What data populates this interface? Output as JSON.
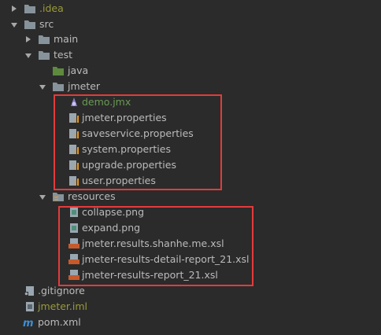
{
  "tree": {
    "idea": {
      "label": ".idea",
      "icon": "folder-icon"
    },
    "src": {
      "label": "src",
      "icon": "folder-icon"
    },
    "main": {
      "label": "main",
      "icon": "folder-icon"
    },
    "test": {
      "label": "test",
      "icon": "folder-icon"
    },
    "java": {
      "label": "java",
      "icon": "source-folder-icon"
    },
    "jmeter": {
      "label": "jmeter",
      "icon": "folder-icon"
    },
    "jmeter_files": [
      {
        "label": "demo.jmx",
        "icon": "jmx-file-icon"
      },
      {
        "label": "jmeter.properties",
        "icon": "properties-file-icon"
      },
      {
        "label": "saveservice.properties",
        "icon": "properties-file-icon"
      },
      {
        "label": "system.properties",
        "icon": "properties-file-icon"
      },
      {
        "label": "upgrade.properties",
        "icon": "properties-file-icon"
      },
      {
        "label": "user.properties",
        "icon": "properties-file-icon"
      }
    ],
    "resources": {
      "label": "resources",
      "icon": "resources-folder-icon"
    },
    "resource_files": [
      {
        "label": "collapse.png",
        "icon": "image-file-icon"
      },
      {
        "label": "expand.png",
        "icon": "image-file-icon"
      },
      {
        "label": "jmeter.results.shanhe.me.xsl",
        "icon": "xsl-file-icon"
      },
      {
        "label": "jmeter-results-detail-report_21.xsl",
        "icon": "xsl-file-icon"
      },
      {
        "label": "jmeter-results-report_21.xsl",
        "icon": "xsl-file-icon"
      }
    ],
    "gitignore": {
      "label": ".gitignore",
      "icon": "gitignore-file-icon"
    },
    "iml": {
      "label": "jmeter.iml",
      "icon": "iml-file-icon"
    },
    "pom": {
      "label": "pom.xml",
      "icon": "maven-file-icon"
    }
  },
  "colors": {
    "background": "#2b2b2b",
    "text": "#bbbbbb",
    "folder": "#87939a",
    "highlight_box": "#e33b3b",
    "modified_green": "#6a9a54",
    "ignored_olive": "#9a9a3b"
  }
}
